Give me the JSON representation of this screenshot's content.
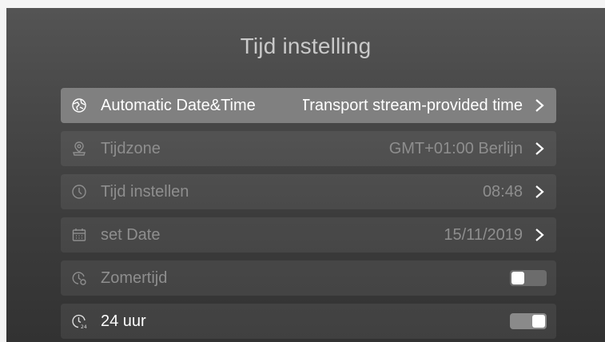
{
  "header": {
    "title": "Tijd instelling"
  },
  "settings": [
    {
      "label": "Automatic Date&Time",
      "value": "Transport stream-provided time",
      "icon": "globe-clock-icon"
    },
    {
      "label": "Tijdzone",
      "value": "GMT+01:00 Berlijn",
      "icon": "location-pin-icon"
    },
    {
      "label": "Tijd instellen",
      "value": "08:48",
      "icon": "clock-icon"
    },
    {
      "label": "set Date",
      "value": "15/11/2019",
      "icon": "calendar-icon"
    },
    {
      "label": "Zomertijd",
      "toggle": "off",
      "icon": "daylight-saving-clock-icon"
    },
    {
      "label": "24 uur",
      "toggle": "on",
      "icon": "clock-24-icon"
    }
  ],
  "colors": {
    "selected_row": "#808080",
    "row_background": "#474747",
    "text_dim": "#8e8e8e",
    "text_bright": "#ffffff"
  }
}
